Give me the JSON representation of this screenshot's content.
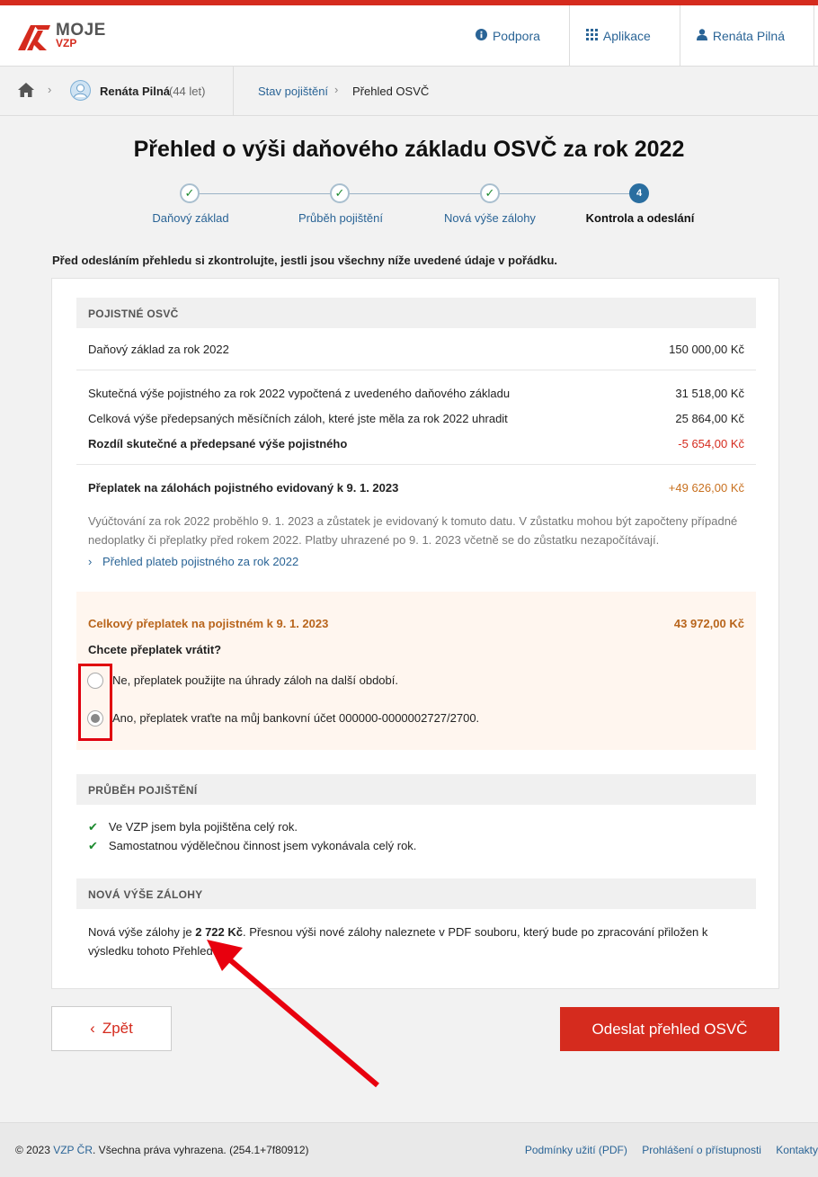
{
  "header": {
    "logo_moje": "MOJE",
    "logo_vzp": "VZP",
    "nav": [
      {
        "label": "Podpora",
        "icon": "info-icon"
      },
      {
        "label": "Aplikace",
        "icon": "grid-icon"
      },
      {
        "label": "Renáta Pilná",
        "icon": "user-icon"
      }
    ]
  },
  "breadcrumb": {
    "user_name": "Renáta Pilná",
    "user_age": "(44 let)",
    "items": [
      "Stav pojištění",
      "Přehled OSVČ"
    ]
  },
  "page": {
    "title": "Přehled o výši daňového základu OSVČ za rok 2022",
    "steps": [
      {
        "label": "Daňový základ",
        "state": "done"
      },
      {
        "label": "Průběh pojištění",
        "state": "done"
      },
      {
        "label": "Nová výše zálohy",
        "state": "done"
      },
      {
        "label": "Kontrola a odeslání",
        "state": "active",
        "number": "4"
      }
    ],
    "intro": "Před odesláním přehledu si zkontrolujte, jestli jsou všechny níže uvedené údaje v pořádku."
  },
  "pojistne": {
    "heading": "POJISTNÉ OSVČ",
    "rows": [
      {
        "label": "Daňový základ za rok 2022",
        "value": "150 000,00 Kč"
      },
      {
        "label": "Skutečná výše pojistného za rok 2022 vypočtená z uvedeného daňového základu",
        "value": "31 518,00 Kč"
      },
      {
        "label": "Celková výše předepsaných měsíčních záloh, které jste měla za rok 2022 uhradit",
        "value": "25 864,00 Kč"
      },
      {
        "label": "Rozdíl skutečné a předepsané výše pojistného",
        "value": "-5 654,00 Kč"
      },
      {
        "label": "Přeplatek na zálohách pojistného evidovaný k 9. 1. 2023",
        "value": "+49 626,00 Kč"
      }
    ],
    "note": "Vyúčtování za rok 2022 proběhlo 9. 1. 2023 a zůstatek je evidovaný k tomuto datu. V zůstatku mohou být započteny případné nedoplatky či přeplatky před rokem 2022. Platby uhrazené po 9. 1. 2023 včetně se do zůstatku nezapočítávají.",
    "link": "Přehled plateb pojistného za rok 2022"
  },
  "refund": {
    "title": "Celkový přeplatek na pojistném k 9. 1. 2023",
    "value": "43 972,00 Kč",
    "question": "Chcete přeplatek vrátit?",
    "options": [
      {
        "label": "Ne, přeplatek použijte na úhrady záloh na další období.",
        "checked": false
      },
      {
        "label": "Ano, přeplatek vraťte na můj bankovní účet 000000-0000002727/2700.",
        "checked": true
      }
    ]
  },
  "prubeh": {
    "heading": "PRŮBĚH POJIŠTĚNÍ",
    "items": [
      "Ve VZP jsem byla pojištěna celý rok.",
      "Samostatnou výdělečnou činnost jsem vykonávala celý rok."
    ]
  },
  "zaloha": {
    "heading": "NOVÁ VÝŠE ZÁLOHY",
    "text_before": "Nová výše zálohy je ",
    "amount": "2 722 Kč",
    "text_after": ". Přesnou výši nové zálohy naleznete v PDF souboru, který bude po zpracování přiložen k výsledku tohoto Přehledu."
  },
  "buttons": {
    "back": "Zpět",
    "send": "Odeslat přehled OSVČ"
  },
  "footer": {
    "copyright_prefix": "© 2023 ",
    "copyright_link": "VZP ČR",
    "copyright_suffix": ". Všechna práva vyhrazena. (254.1+7f80912)",
    "links": [
      "Podmínky užití (PDF)",
      "Prohlášení o přístupnosti",
      "Kontakty"
    ]
  },
  "colors": {
    "brand_red": "#d52b1e",
    "link_blue": "#2a6496",
    "refund_orange": "#b8651c",
    "check_green": "#1c8a2e"
  }
}
